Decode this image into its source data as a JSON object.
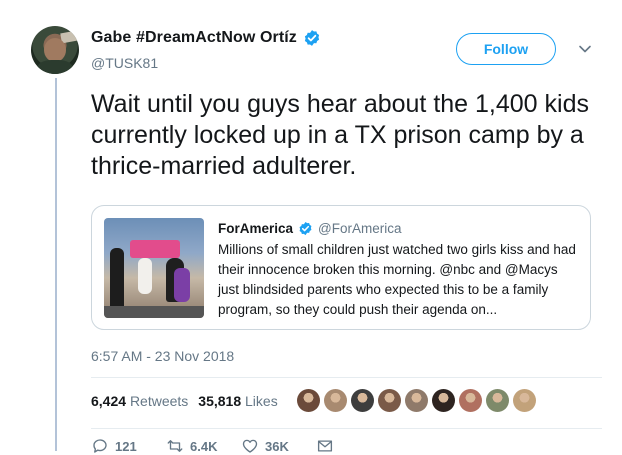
{
  "tweet": {
    "display_name": "Gabe #DreamActNow Ortíz",
    "handle": "@TUSK81",
    "follow_label": "Follow",
    "text": "Wait until you guys hear about the 1,400 kids currently locked up in a TX prison camp by a thrice-married adulterer.",
    "timestamp": "6:57 AM - 23 Nov 2018"
  },
  "quote": {
    "name": "ForAmerica",
    "handle": "@ForAmerica",
    "text": "Millions of small children just watched two girls kiss and had their innocence broken this morning. @nbc and @Macys just blindsided parents who expected this to be a family program, so they could push their agenda on..."
  },
  "stats": {
    "retweets_count": "6,424",
    "retweets_label": "Retweets",
    "likes_count": "35,818",
    "likes_label": "Likes"
  },
  "likers": [
    "#6b4a3a",
    "#a88a70",
    "#3d3d3d",
    "#7a5a48",
    "#8f7a6a",
    "#2e2420",
    "#b07060",
    "#7e8a6a",
    "#c2a27a"
  ],
  "actions": {
    "reply_count": "121",
    "retweet_count": "6.4K",
    "like_count": "36K"
  },
  "colors": {
    "accent": "#1da1f2",
    "muted": "#657786",
    "thread_line": "#b3c3d8"
  }
}
